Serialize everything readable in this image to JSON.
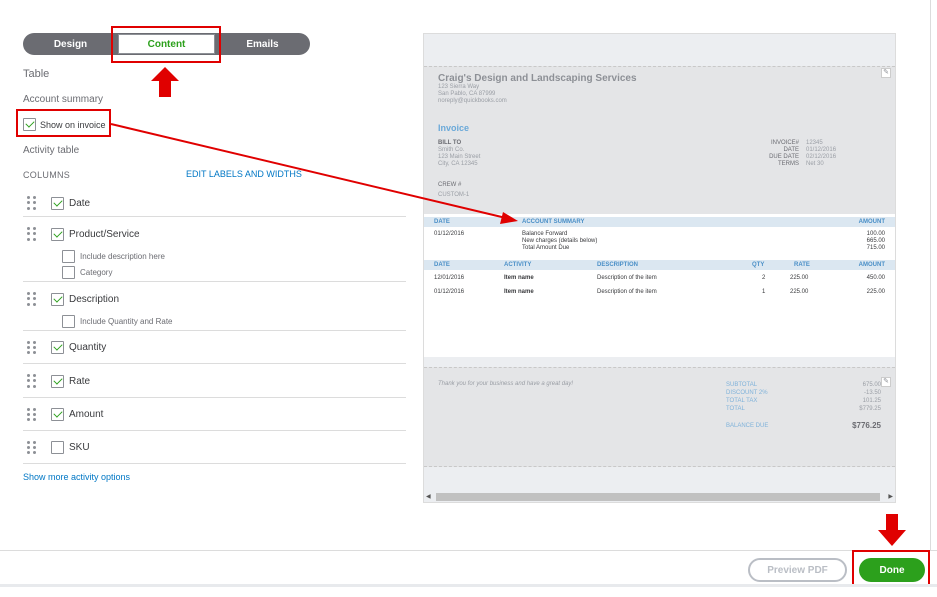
{
  "tabs": [
    {
      "label": "Design"
    },
    {
      "label": "Content"
    },
    {
      "label": "Emails"
    }
  ],
  "left": {
    "table_heading": "Table",
    "account_summary_label": "Account summary",
    "show_on_invoice_label": "Show on invoice",
    "activity_table_label": "Activity table",
    "columns_label": "COLUMNS",
    "edit_labels_link": "EDIT LABELS AND WIDTHS",
    "columns": [
      {
        "label": "Date",
        "checked": true,
        "subs": []
      },
      {
        "label": "Product/Service",
        "checked": true,
        "subs": [
          {
            "label": "Include description here",
            "checked": false
          },
          {
            "label": "Category",
            "checked": false
          }
        ]
      },
      {
        "label": "Description",
        "checked": true,
        "subs": [
          {
            "label": "Include Quantity and Rate",
            "checked": false
          }
        ]
      },
      {
        "label": "Quantity",
        "checked": true,
        "subs": []
      },
      {
        "label": "Rate",
        "checked": true,
        "subs": []
      },
      {
        "label": "Amount",
        "checked": true,
        "subs": []
      },
      {
        "label": "SKU",
        "checked": false,
        "subs": []
      }
    ],
    "more_link": "Show more activity options"
  },
  "preview": {
    "company": "Craig's Design and Landscaping Services",
    "address1": "123 Sierra Way",
    "address2": "San Pablo, CA 87999",
    "email": "noreply@quickbooks.com",
    "invoice_title": "Invoice",
    "bill_to_label": "BILL TO",
    "bill_to_name": "Smith Co.",
    "bill_to_addr1": "123 Main Street",
    "bill_to_addr2": "City, CA 12345",
    "meta_labels": [
      "INVOICE#",
      "DATE",
      "DUE DATE",
      "TERMS"
    ],
    "meta_values": [
      "12345",
      "01/12/2016",
      "02/12/2016",
      "Net 30"
    ],
    "crew_label": "CREW #",
    "custom_label": "CUSTOM-1",
    "summary_headers": {
      "date": "DATE",
      "account": "ACCOUNT SUMMARY",
      "amount": "AMOUNT"
    },
    "summary_date": "01/12/2016",
    "summary_lines": [
      "Balance Forward",
      "New charges (details below)",
      "Total Amount Due"
    ],
    "summary_amounts": [
      "100.00",
      "665.00",
      "715.00"
    ],
    "activity_headers": {
      "date": "DATE",
      "activity": "ACTIVITY",
      "description": "DESCRIPTION",
      "qty": "QTY",
      "rate": "RATE",
      "amount": "AMOUNT"
    },
    "activity_rows": [
      {
        "date": "12/01/2016",
        "activity": "Item name",
        "description": "Description of the item",
        "qty": "2",
        "rate": "225.00",
        "amount": "450.00"
      },
      {
        "date": "01/12/2016",
        "activity": "Item name",
        "description": "Description of the item",
        "qty": "1",
        "rate": "225.00",
        "amount": "225.00"
      }
    ],
    "thanks": "Thank you for your business and have a great day!",
    "totals_labels": [
      "SUBTOTAL",
      "DISCOUNT 2%",
      "TOTAL TAX",
      "TOTAL"
    ],
    "totals_values": [
      "675.00",
      "-13.50",
      "101.25",
      "$779.25"
    ],
    "balance_label": "BALANCE DUE",
    "balance_value": "$776.25"
  },
  "footer": {
    "preview_pdf": "Preview PDF",
    "done": "Done"
  },
  "colors": {
    "accent_green": "#2ca01c",
    "link_blue": "#0077c5",
    "annotation_red": "#e00000"
  }
}
